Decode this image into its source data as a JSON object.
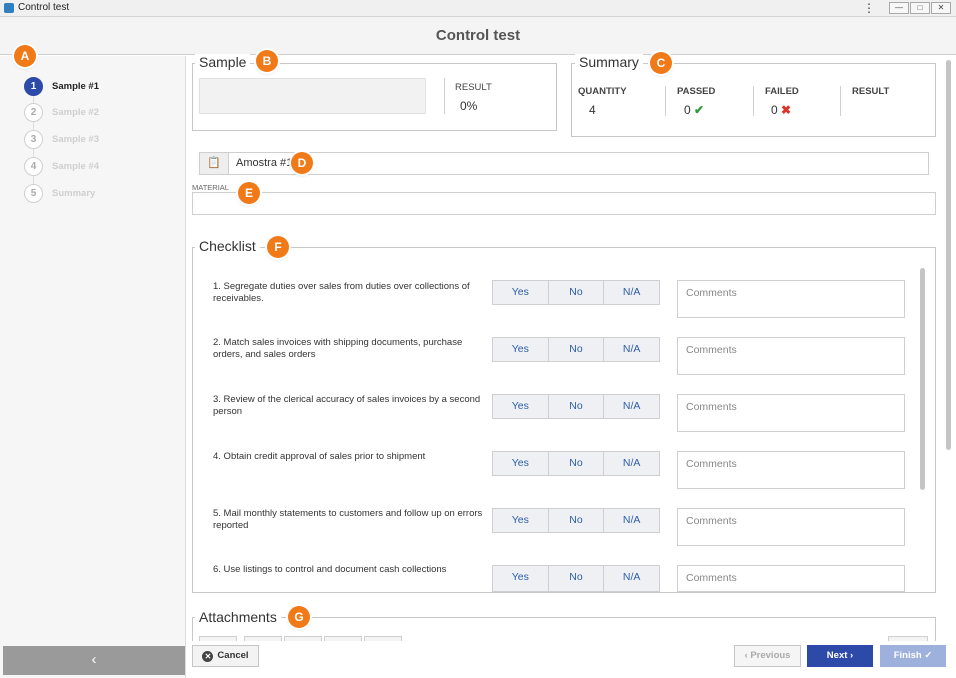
{
  "window": {
    "title": "Control test",
    "menu_icon": "vertical-dots-icon",
    "min_label": "—",
    "max_label": "□",
    "close_label": "✕"
  },
  "header": {
    "title": "Control test"
  },
  "sidebar": {
    "steps": [
      {
        "num": "1",
        "label": "Sample #1"
      },
      {
        "num": "2",
        "label": "Sample #2"
      },
      {
        "num": "3",
        "label": "Sample #3"
      },
      {
        "num": "4",
        "label": "Sample #4"
      },
      {
        "num": "5",
        "label": "Summary"
      }
    ],
    "collapse_label": "‹"
  },
  "badges": {
    "a": "A",
    "b": "B",
    "c": "C",
    "d": "D",
    "e": "E",
    "f": "F",
    "g": "G"
  },
  "sample": {
    "title": "Sample",
    "result_label": "RESULT",
    "result_value": "0%"
  },
  "summary": {
    "title": "Summary",
    "quantity_label": "QUANTITY",
    "quantity_value": "4",
    "passed_label": "PASSED",
    "passed_value": "0",
    "passed_icon": "✔",
    "failed_label": "FAILED",
    "failed_value": "0",
    "failed_icon": "✖",
    "result_label": "RESULT"
  },
  "sample_field": {
    "value": "Amostra #1",
    "icon": "📋"
  },
  "material": {
    "label": "MATERIAL",
    "value": ""
  },
  "checklist": {
    "title": "Checklist",
    "yes_label": "Yes",
    "no_label": "No",
    "na_label": "N/A",
    "comment_placeholder": "Comments",
    "items": [
      "1. Segregate duties over sales from duties over collections of receivables.",
      "2. Match sales invoices with shipping documents, purchase orders, and sales orders",
      "3. Review of the clerical accuracy of sales invoices by a second person",
      "4. Obtain credit approval of sales prior to shipment",
      "5. Mail monthly statements to customers and follow up on errors reported",
      "6. Use listings to control and document cash collections"
    ]
  },
  "attachments": {
    "title": "Attachments"
  },
  "footer": {
    "cancel_label": "Cancel",
    "cancel_icon": "✕",
    "previous_label": "‹  Previous",
    "next_label": "Next  ›",
    "finish_label": "Finish ✓"
  },
  "colors": {
    "accent": "#2e4aa8",
    "badge": "#f07a18",
    "passed": "#2f9a3a",
    "failed": "#d9362b"
  }
}
